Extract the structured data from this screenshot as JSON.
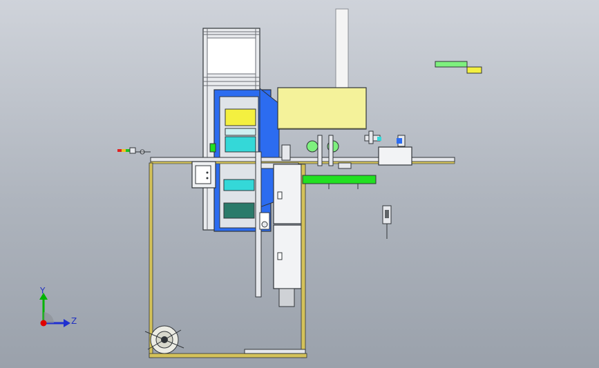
{
  "viewport": {
    "background_top": "#cfd3da",
    "background_bottom": "#9aa1ab"
  },
  "triad": {
    "y_label": "Y",
    "z_label": "Z",
    "y_color": "#00b400",
    "z_color": "#2030d0",
    "x_color": "#e00000"
  },
  "model": {
    "colors": {
      "frame_yellow": "#d4c25a",
      "hood_yellow": "#f4f29a",
      "accent_green": "#22e022",
      "accent_blue": "#2c6cf0",
      "cyan": "#34d8d8",
      "teal": "#2a7a6a",
      "light_green": "#7ef07e",
      "bright_yellow": "#f4f040",
      "steel": "#e6e8ec",
      "outline": "#303438"
    }
  }
}
